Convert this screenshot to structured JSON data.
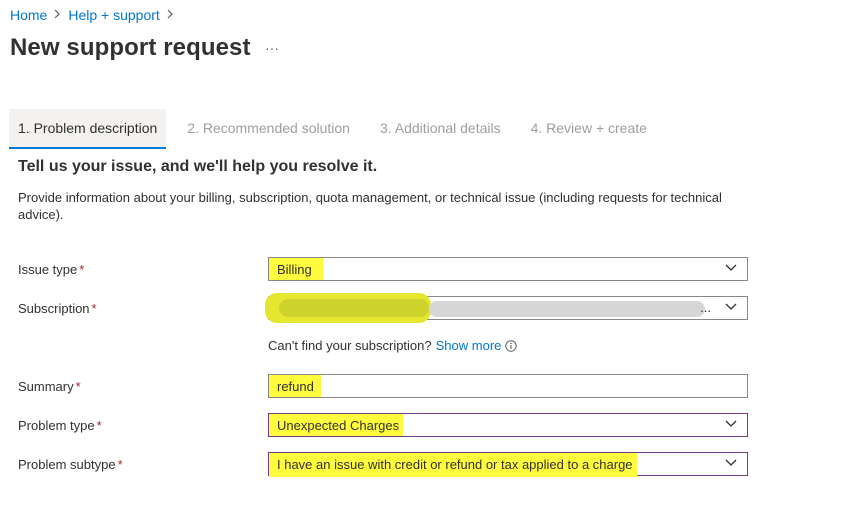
{
  "breadcrumb": {
    "items": [
      "Home",
      "Help + support"
    ]
  },
  "page": {
    "title": "New support request",
    "more_label": "···"
  },
  "tabs": [
    {
      "label": "1. Problem description",
      "active": true
    },
    {
      "label": "2. Recommended solution",
      "active": false
    },
    {
      "label": "3. Additional details",
      "active": false
    },
    {
      "label": "4. Review + create",
      "active": false
    }
  ],
  "section": {
    "heading": "Tell us your issue, and we'll help you resolve it.",
    "description": "Provide information about your billing, subscription, quota management, or technical issue (including requests for technical advice)."
  },
  "form": {
    "required_marker": "*",
    "issue_type": {
      "label": "Issue type",
      "value": "Billing"
    },
    "subscription": {
      "label": "Subscription",
      "value": "",
      "ellipsis": "..."
    },
    "cant_find": {
      "text": "Can't find your subscription?",
      "link": "Show more"
    },
    "summary": {
      "label": "Summary",
      "value": "refund"
    },
    "problem_type": {
      "label": "Problem type",
      "value": "Unexpected Charges"
    },
    "problem_subtype": {
      "label": "Problem subtype",
      "value": "I have an issue with credit or refund or tax applied to a charge"
    }
  },
  "colors": {
    "link": "#0078d4",
    "highlight": "#fff34d",
    "required": "#a4262c",
    "accent_border": "#7a3a8c"
  }
}
